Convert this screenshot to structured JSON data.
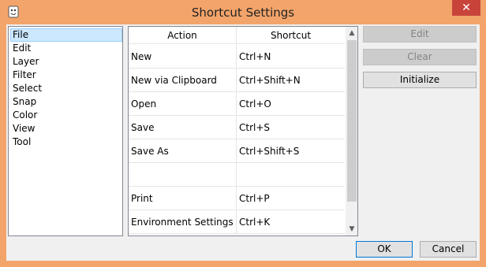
{
  "window": {
    "title": "Shortcut Settings",
    "close_glyph": "✕",
    "app_icon": "app-icon"
  },
  "categories": [
    {
      "label": "File",
      "selected": true
    },
    {
      "label": "Edit",
      "selected": false
    },
    {
      "label": "Layer",
      "selected": false
    },
    {
      "label": "Filter",
      "selected": false
    },
    {
      "label": "Select",
      "selected": false
    },
    {
      "label": "Snap",
      "selected": false
    },
    {
      "label": "Color",
      "selected": false
    },
    {
      "label": "View",
      "selected": false
    },
    {
      "label": "Tool",
      "selected": false
    }
  ],
  "table": {
    "columns": [
      "Action",
      "Shortcut"
    ],
    "rows": [
      {
        "action": "New",
        "shortcut": "Ctrl+N"
      },
      {
        "action": "New via Clipboard",
        "shortcut": "Ctrl+Shift+N"
      },
      {
        "action": "Open",
        "shortcut": "Ctrl+O"
      },
      {
        "action": "Save",
        "shortcut": "Ctrl+S"
      },
      {
        "action": "Save As",
        "shortcut": "Ctrl+Shift+S"
      },
      {
        "action": "",
        "shortcut": ""
      },
      {
        "action": "Print",
        "shortcut": "Ctrl+P"
      },
      {
        "action": "Environment Settings",
        "shortcut": "Ctrl+K"
      }
    ],
    "scroll_up_glyph": "▲",
    "scroll_down_glyph": "▼"
  },
  "buttons": {
    "edit": "Edit",
    "clear": "Clear",
    "initialize": "Initialize",
    "ok": "OK",
    "cancel": "Cancel"
  },
  "colors": {
    "titlebar": "#f3a46a",
    "close": "#c8443b",
    "selection": "#cce8ff",
    "default_button_border": "#0078d7"
  }
}
